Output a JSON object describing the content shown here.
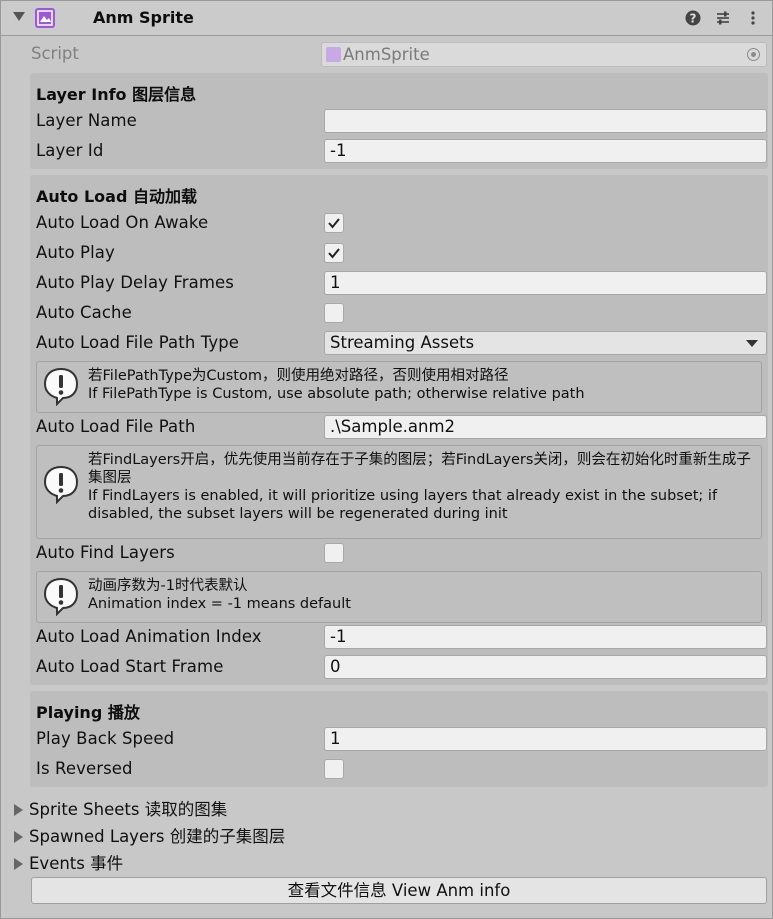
{
  "component": {
    "title": "Anm Sprite",
    "icon": "sprite-icon",
    "accent_color": "#9b59d8"
  },
  "script": {
    "label": "Script",
    "value": "AnmSprite"
  },
  "layer_info": {
    "title": "Layer Info 图层信息",
    "layer_name_label": "Layer Name",
    "layer_name_value": "",
    "layer_id_label": "Layer Id",
    "layer_id_value": "-1"
  },
  "auto_load": {
    "title": "Auto Load 自动加载",
    "on_awake_label": "Auto Load On Awake",
    "on_awake_checked": true,
    "auto_play_label": "Auto Play",
    "auto_play_checked": true,
    "delay_label": "Auto Play Delay Frames",
    "delay_value": "1",
    "cache_label": "Auto Cache",
    "cache_checked": false,
    "path_type_label": "Auto Load File Path Type",
    "path_type_value": "Streaming Assets",
    "help_path_type_zh": "若FilePathType为Custom，则使用绝对路径，否则使用相对路径",
    "help_path_type_en": "If FilePathType is Custom, use absolute path; otherwise relative path",
    "file_path_label": "Auto Load File Path",
    "file_path_value": ".\\Sample.anm2",
    "help_find_layers_zh": "若FindLayers开启，优先使用当前存在于子集的图层；若FindLayers关闭，则会在初始化时重新生成子集图层",
    "help_find_layers_en": "If FindLayers is enabled, it will prioritize using layers that already exist in the subset; if disabled, the subset layers will be regenerated during init",
    "find_layers_label": "Auto Find Layers",
    "find_layers_checked": false,
    "help_anim_index_zh": "动画序数为-1时代表默认",
    "help_anim_index_en": "Animation index = -1 means default",
    "anim_index_label": "Auto Load Animation Index",
    "anim_index_value": "-1",
    "start_frame_label": "Auto Load Start Frame",
    "start_frame_value": "0"
  },
  "playing": {
    "title": "Playing 播放",
    "speed_label": "Play Back Speed",
    "speed_value": "1",
    "reversed_label": "Is Reversed",
    "reversed_checked": false
  },
  "foldouts": {
    "sprite_sheets": "Sprite Sheets 读取的图集",
    "spawned_layers": "Spawned Layers 创建的子集图层",
    "events": "Events 事件"
  },
  "button": {
    "view_info": "查看文件信息 View Anm info"
  }
}
